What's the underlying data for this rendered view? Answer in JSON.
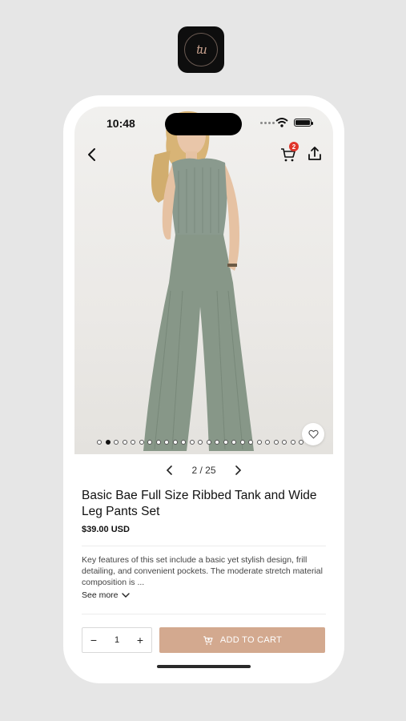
{
  "status": {
    "time": "10:48"
  },
  "header": {
    "cart_count": "2"
  },
  "gallery": {
    "current": 2,
    "total": 25,
    "pager_text": "2 / 25"
  },
  "product": {
    "title": "Basic Bae Full Size Ribbed Tank and Wide Leg Pants Set",
    "price": "$39.00 USD",
    "description": "Key features of this set include a basic yet stylish design, frill detailing, and convenient pockets. The moderate stretch material composition is ...",
    "see_more": "See more"
  },
  "cart": {
    "quantity": "1",
    "minus": "−",
    "plus": "+",
    "add_label": "ADD TO CART"
  },
  "colors": {
    "accent": "#d3a98f",
    "badge": "#e0352b",
    "outfit": "#8a9a8e"
  },
  "icons": [
    "back-icon",
    "cart-icon",
    "share-icon",
    "heart-icon",
    "chevron-left-icon",
    "chevron-right-icon",
    "chevron-down-icon",
    "wifi-icon",
    "battery-icon"
  ]
}
